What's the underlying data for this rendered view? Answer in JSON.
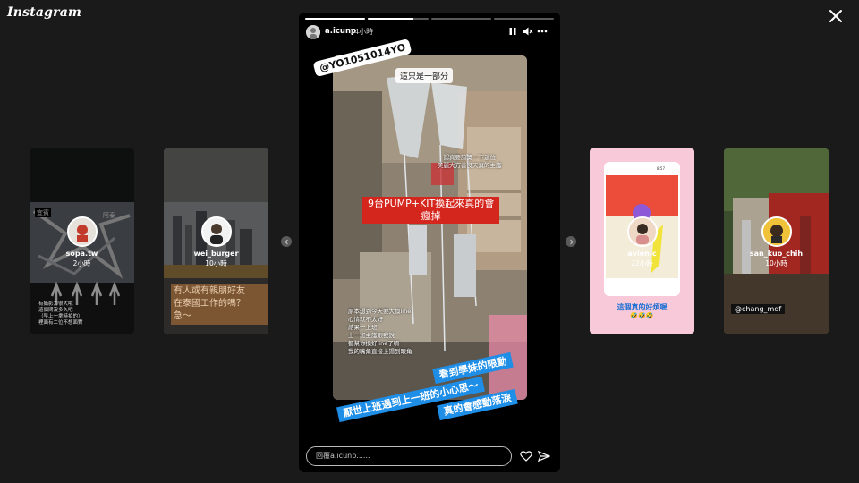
{
  "app": {
    "logo": "Instagram"
  },
  "left_cards": [
    {
      "user": "sopa.tw",
      "time": "2小時",
      "overlay_a": "宜賓",
      "overlay_b": "阿泰",
      "caption": "有攝影力很大哦\n這個問沒多久吧\n（早上一拿時拍的）\n裡面有二位不想面對"
    },
    {
      "user": "wei_burger",
      "time": "10小時",
      "caption": "有人或有親朋好友\n在泰國工作的嗎？\n急～"
    }
  ],
  "story": {
    "user": "a.icunp",
    "time": "14小時",
    "progress": [
      1.0,
      0.75,
      0.0,
      0.0
    ],
    "mention": "@YO1051014YO",
    "top_caption": "這只是一部分",
    "side_caption": "認真要誇獎一下這位\n美麗大方善良天真的主護",
    "red_text": "9台PUMP+KIT換起來真的會\n瘋掉",
    "lower_caption": "原本想到今天要大換line\n心情就不太好\n結果一上班\n上一班主護跟我說\n都幫你換好line了唷\n我的嘴角直接上揚到眼角",
    "blue_1": "看到學妹的限動",
    "blue_2": "厭世上班遇到上一班的小心思～",
    "blue_3": "真的會感動落淚",
    "reply_placeholder": "回覆a.icunp......"
  },
  "right_cards": [
    {
      "user": "avien.c",
      "time": "22小時",
      "caption": "這個真的好煩喔",
      "emoji": "🤣🤣🤣",
      "inner_time": "8:57"
    },
    {
      "user": "san_kuo_chih",
      "time": "10小時",
      "tag": "@chang_mdf"
    }
  ],
  "icons": {
    "close": "close-icon",
    "pause": "pause-icon",
    "mute": "mute-icon",
    "more": "more-icon",
    "heart": "heart-icon",
    "send": "send-icon"
  }
}
